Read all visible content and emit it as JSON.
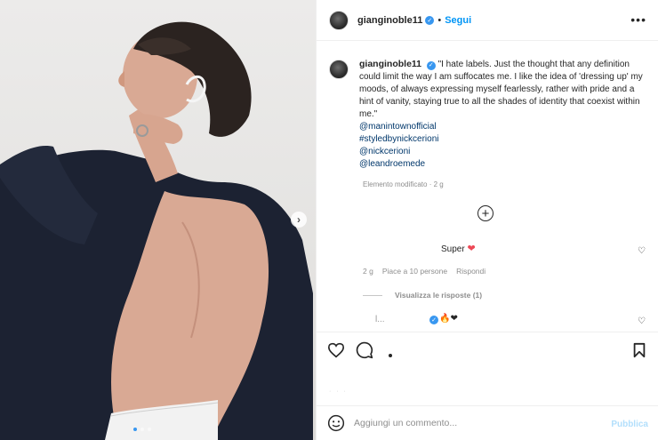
{
  "post": {
    "username": "gianginoble11",
    "follow_label": "Segui",
    "separator": "•",
    "more_icon": "more-horizontal-icon",
    "verified_icon": "verified-badge-icon"
  },
  "caption": {
    "username": "gianginoble11",
    "text": "\"I hate labels. Just the thought that any definition could limit the way I am suffocates me. I like the idea of 'dressing up' my moods, of always expressing myself fearlessly, rather with pride and a hint of vanity, staying true to all the shades of identity that coexist within me.\"",
    "tags": [
      "@manintownofficial",
      "#styledbynickcerioni",
      "@nickcerioni",
      "@leandroemede"
    ],
    "edited_note": "Elemento modificato · 2 g"
  },
  "load_more_icon": "plus-circle-icon",
  "comments": [
    {
      "text": "Super",
      "emoji": "❤",
      "age": "2 g",
      "likes": "Piace a 10 persone",
      "reply_label": "Rispondi",
      "view_replies": "Visualizza le risposte (1)"
    },
    {
      "name": "l...",
      "emoji": "🔥❤"
    }
  ],
  "actions": {
    "like_icon": "heart-icon",
    "comment_icon": "comment-icon",
    "share_icon": "share-icon",
    "save_icon": "bookmark-icon"
  },
  "likes_placeholder": "· · ·",
  "composer": {
    "emoji_icon": "smiley-icon",
    "placeholder": "Aggiungi un commento...",
    "publish_label": "Pubblica"
  },
  "carousel": {
    "next_icon": "chevron-right-icon",
    "slides": 3,
    "active": 1
  },
  "colors": {
    "accent": "#0095f6",
    "verified": "#3897f0",
    "heart": "#ed4956",
    "muted": "#8e8e8e"
  }
}
